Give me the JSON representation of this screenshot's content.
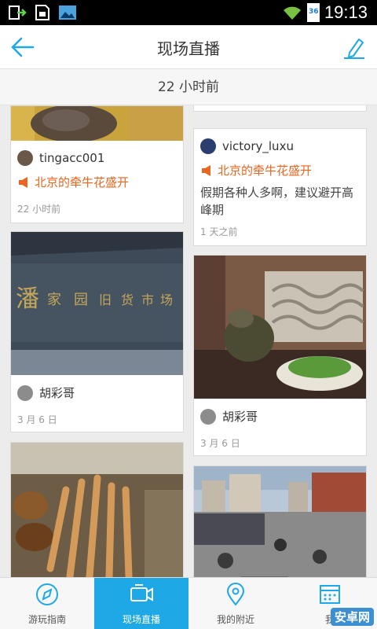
{
  "status_bar": {
    "time": "19:13",
    "battery": "36"
  },
  "header": {
    "title": "现场直播"
  },
  "time_banner": "22 小时前",
  "posts": [
    {
      "username": "tingacc001",
      "topic": "北京的牵牛花盛开",
      "date": "22 小时前"
    },
    {
      "username": "victory_luxu",
      "topic": "北京的牵牛花盛开",
      "description": "假期各种人多啊，建议避开高峰期",
      "date": "1 天之前"
    },
    {
      "username": "胡彩哥",
      "date": "3 月 6 日"
    },
    {
      "username": "胡彩哥",
      "date": "3 月 6 日"
    }
  ],
  "tabs": [
    {
      "label": "游玩指南",
      "icon": "compass-icon"
    },
    {
      "label": "现场直播",
      "icon": "video-camera-icon",
      "active": true
    },
    {
      "label": "我的附近",
      "icon": "location-pin-icon"
    },
    {
      "label": "我",
      "icon": "calendar-icon"
    }
  ],
  "watermark": "安卓网",
  "colors": {
    "accent": "#1ea8e5",
    "topic": "#e8661f"
  }
}
